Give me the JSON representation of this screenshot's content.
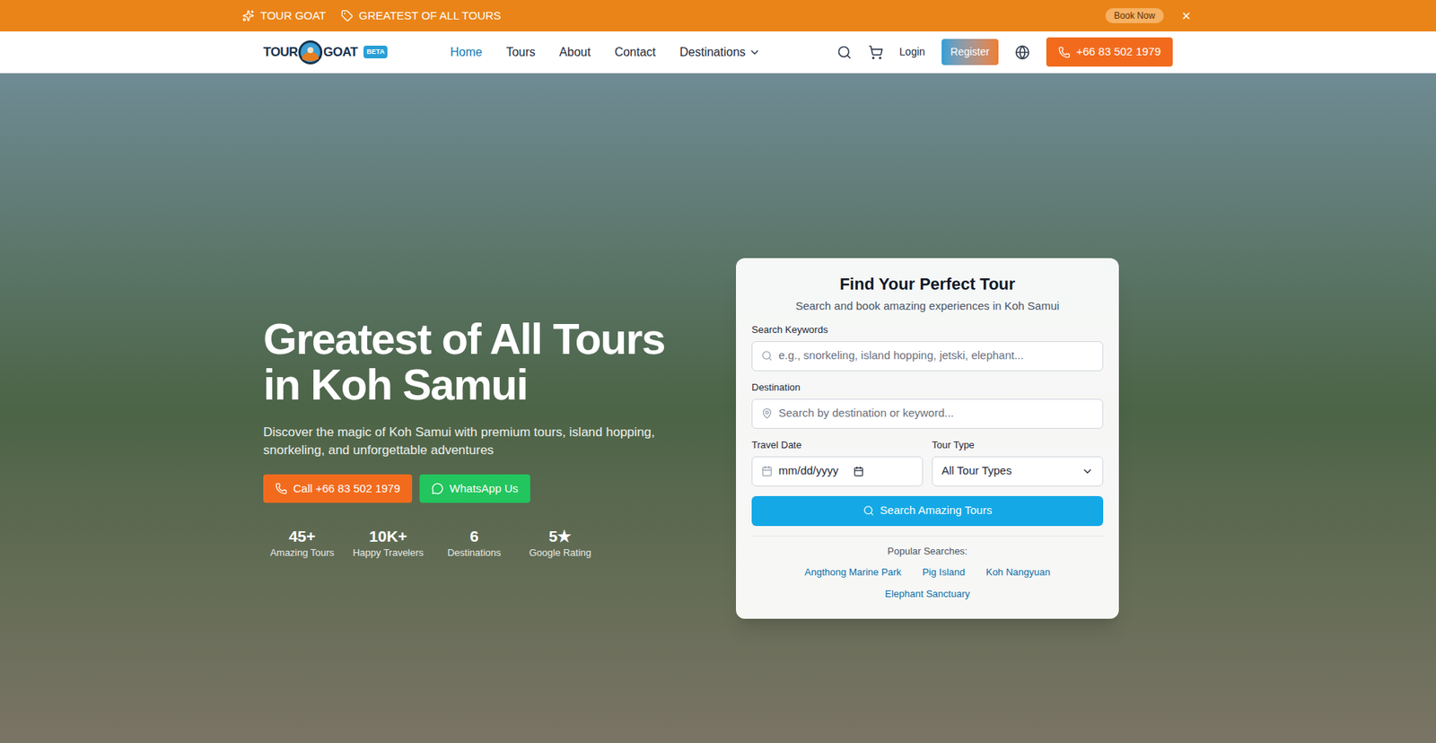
{
  "top_bar": {
    "items": [
      "TOUR GOAT",
      "GREATEST OF ALL TOURS"
    ],
    "cta": "Book Now",
    "close": "×"
  },
  "nav": {
    "logo": {
      "left": "TOUR",
      "right": "GOAT",
      "badge": "BETA"
    },
    "links": [
      {
        "label": "Home",
        "selected": true,
        "dropdown": false
      },
      {
        "label": "Tours",
        "selected": false,
        "dropdown": false
      },
      {
        "label": "About",
        "selected": false,
        "dropdown": false
      },
      {
        "label": "Contact",
        "selected": false,
        "dropdown": false
      },
      {
        "label": "Destinations",
        "selected": false,
        "dropdown": true
      }
    ],
    "login": "Login",
    "register": "Register",
    "phone": "+66 83 502 1979"
  },
  "hero": {
    "title_lines": [
      "Greatest of All Tours",
      "in Koh Samui"
    ],
    "subtitle": "Discover the magic of Koh Samui with premium tours, island hopping, snorkeling, and unforgettable adventures",
    "buttons": [
      {
        "label": "Call +66 83 502 1979",
        "kind": "call"
      },
      {
        "label": "WhatsApp Us",
        "kind": "whatsapp"
      }
    ],
    "stats": [
      {
        "value": "45+",
        "label": "Amazing Tours"
      },
      {
        "value": "10K+",
        "label": "Happy Travelers"
      },
      {
        "value": "6",
        "label": "Destinations"
      },
      {
        "value": "5★",
        "label": "Google Rating"
      }
    ]
  },
  "search_card": {
    "title": "Find Your Perfect Tour",
    "subtitle": "Search and book amazing experiences in Koh Samui",
    "keywords": {
      "label": "Search Keywords",
      "placeholder": "e.g., snorkeling, island hopping, jetski, elephant..."
    },
    "destination": {
      "label": "Destination",
      "placeholder": "Search by destination or keyword..."
    },
    "date": {
      "label": "Travel Date",
      "placeholder": "mm/dd/yyyy"
    },
    "tour_type": {
      "label": "Tour Type",
      "value": "All Tour Types"
    },
    "button": "Search Amazing Tours",
    "popular_label": "Popular Searches:",
    "popular": [
      "Angthong Marine Park",
      "Pig Island",
      "Koh Nangyuan",
      "Elephant Sanctuary"
    ]
  }
}
